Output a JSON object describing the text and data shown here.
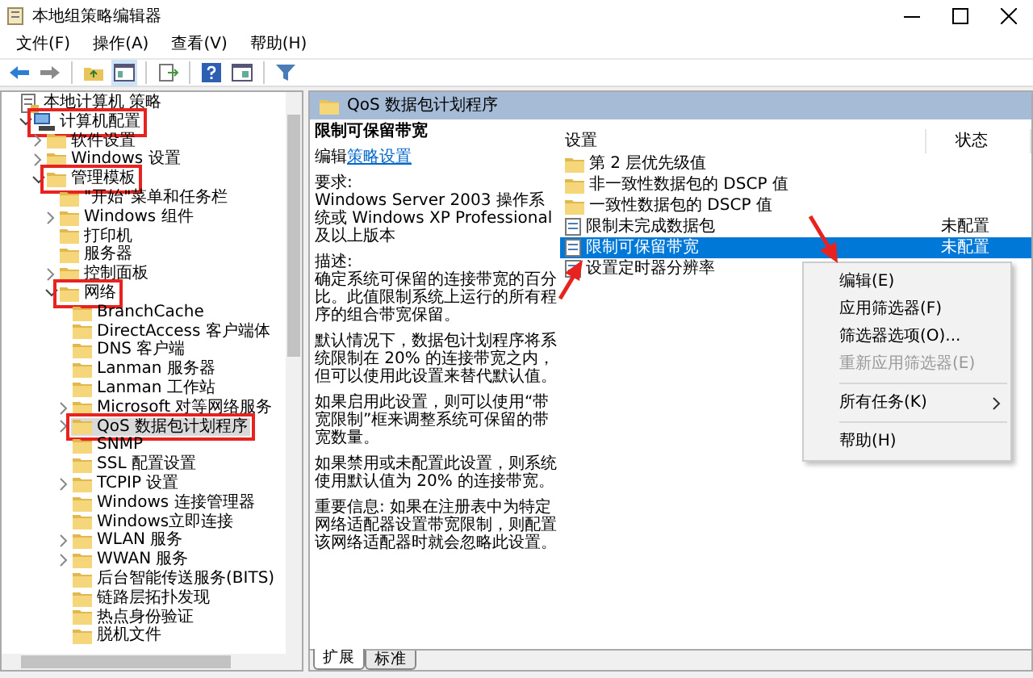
{
  "window": {
    "title": "本地组策略编辑器"
  },
  "menu": [
    "文件(F)",
    "操作(A)",
    "查看(V)",
    "帮助(H)"
  ],
  "tree": [
    {
      "label": "本地计算机 策略",
      "kind": "policy",
      "selected": false,
      "annotated": false,
      "children": [
        {
          "label": "计算机配置",
          "kind": "computer",
          "expanded": true,
          "selected": false,
          "annotated": true,
          "children": [
            {
              "label": "软件设置",
              "kind": "folder",
              "expanded": false,
              "selected": false,
              "annotated": false
            },
            {
              "label": "Windows 设置",
              "kind": "folder",
              "expanded": false,
              "selected": false,
              "annotated": false
            },
            {
              "label": "管理模板",
              "kind": "folder",
              "expanded": true,
              "selected": false,
              "annotated": true,
              "children": [
                {
                  "label": "\"开始\"菜单和任务栏",
                  "kind": "folder",
                  "selected": false,
                  "annotated": false
                },
                {
                  "label": "Windows 组件",
                  "kind": "folder",
                  "expanded": false,
                  "selected": false,
                  "annotated": false
                },
                {
                  "label": "打印机",
                  "kind": "folder",
                  "selected": false,
                  "annotated": false
                },
                {
                  "label": "服务器",
                  "kind": "folder",
                  "selected": false,
                  "annotated": false
                },
                {
                  "label": "控制面板",
                  "kind": "folder",
                  "expanded": false,
                  "selected": false,
                  "annotated": false
                },
                {
                  "label": "网络",
                  "kind": "folder",
                  "expanded": true,
                  "selected": false,
                  "annotated": true,
                  "children": [
                    {
                      "label": "BranchCache",
                      "kind": "folder",
                      "selected": false,
                      "annotated": false
                    },
                    {
                      "label": "DirectAccess 客户端体",
                      "kind": "folder",
                      "selected": false,
                      "annotated": false
                    },
                    {
                      "label": "DNS 客户端",
                      "kind": "folder",
                      "selected": false,
                      "annotated": false
                    },
                    {
                      "label": "Lanman 服务器",
                      "kind": "folder",
                      "selected": false,
                      "annotated": false
                    },
                    {
                      "label": "Lanman 工作站",
                      "kind": "folder",
                      "selected": false,
                      "annotated": false
                    },
                    {
                      "label": "Microsoft 对等网络服务",
                      "kind": "folder",
                      "expanded": false,
                      "selected": false,
                      "annotated": false
                    },
                    {
                      "label": "QoS 数据包计划程序",
                      "kind": "folder",
                      "expanded": false,
                      "selected": true,
                      "annotated": true
                    },
                    {
                      "label": "SNMP",
                      "kind": "folder",
                      "selected": false,
                      "annotated": false
                    },
                    {
                      "label": "SSL 配置设置",
                      "kind": "folder",
                      "selected": false,
                      "annotated": false
                    },
                    {
                      "label": "TCPIP 设置",
                      "kind": "folder",
                      "expanded": false,
                      "selected": false,
                      "annotated": false
                    },
                    {
                      "label": "Windows 连接管理器",
                      "kind": "folder",
                      "selected": false,
                      "annotated": false
                    },
                    {
                      "label": "Windows立即连接",
                      "kind": "folder",
                      "selected": false,
                      "annotated": false
                    },
                    {
                      "label": "WLAN 服务",
                      "kind": "folder",
                      "expanded": false,
                      "selected": false,
                      "annotated": false
                    },
                    {
                      "label": "WWAN 服务",
                      "kind": "folder",
                      "expanded": false,
                      "selected": false,
                      "annotated": false
                    },
                    {
                      "label": "后台智能传送服务(BITS)",
                      "kind": "folder",
                      "selected": false,
                      "annotated": false
                    },
                    {
                      "label": "链路层拓扑发现",
                      "kind": "folder",
                      "selected": false,
                      "annotated": false
                    },
                    {
                      "label": "热点身份验证",
                      "kind": "folder",
                      "selected": false,
                      "annotated": false
                    },
                    {
                      "label": "脱机文件",
                      "kind": "folder",
                      "selected": false,
                      "annotated": false
                    }
                  ]
                }
              ]
            }
          ]
        }
      ]
    }
  ],
  "header": {
    "title": "QoS 数据包计划程序"
  },
  "description": {
    "title": "限制可保留带宽",
    "edit_prefix": "编辑",
    "edit_link": "策略设置",
    "blocks": [
      {
        "heading": "要求:",
        "text": "Windows Server 2003 操作系统或 Windows XP Professional 及以上版本"
      },
      {
        "heading": "描述:",
        "text": "确定系统可保留的连接带宽的百分比。此值限制系统上运行的所有程序的组合带宽保留。"
      },
      {
        "text": "默认情况下，数据包计划程序将系统限制在 20% 的连接带宽之内，但可以使用此设置来替代默认值。"
      },
      {
        "text": "如果启用此设置，则可以使用“带宽限制”框来调整系统可保留的带宽数量。"
      },
      {
        "text": "如果禁用或未配置此设置，则系统使用默认值为 20% 的连接带宽。"
      },
      {
        "text": "重要信息: 如果在注册表中为特定网络适配器设置带宽限制，则配置该网络适配器时就会忽略此设置。"
      }
    ]
  },
  "list": {
    "columns": [
      "设置",
      "状态"
    ],
    "rows": [
      {
        "kind": "folder",
        "name": "第 2 层优先级值",
        "selected": false
      },
      {
        "kind": "folder",
        "name": "非一致性数据包的 DSCP 值",
        "selected": false
      },
      {
        "kind": "folder",
        "name": "一致性数据包的 DSCP 值",
        "selected": false
      },
      {
        "kind": "setting",
        "name": "限制未完成数据包",
        "status": "未配置",
        "selected": false
      },
      {
        "kind": "setting",
        "name": "限制可保留带宽",
        "status": "未配置",
        "selected": true
      },
      {
        "kind": "setting",
        "name": "设置定时器分辨率",
        "selected": false
      }
    ]
  },
  "context_menu": [
    {
      "kind": "item",
      "label": "编辑(E)",
      "disabled": false,
      "submenu": false
    },
    {
      "kind": "item",
      "label": "应用筛选器(F)",
      "disabled": false,
      "submenu": false
    },
    {
      "kind": "item",
      "label": "筛选器选项(O)...",
      "disabled": false,
      "submenu": false
    },
    {
      "kind": "item",
      "label": "重新应用筛选器(E)",
      "disabled": true,
      "submenu": false
    },
    {
      "kind": "separator"
    },
    {
      "kind": "item",
      "label": "所有任务(K)",
      "disabled": false,
      "submenu": true
    },
    {
      "kind": "separator"
    },
    {
      "kind": "item",
      "label": "帮助(H)",
      "disabled": false,
      "submenu": false
    }
  ],
  "tabs": [
    {
      "label": "扩展",
      "selected": true
    },
    {
      "label": "标准",
      "selected": false
    }
  ]
}
